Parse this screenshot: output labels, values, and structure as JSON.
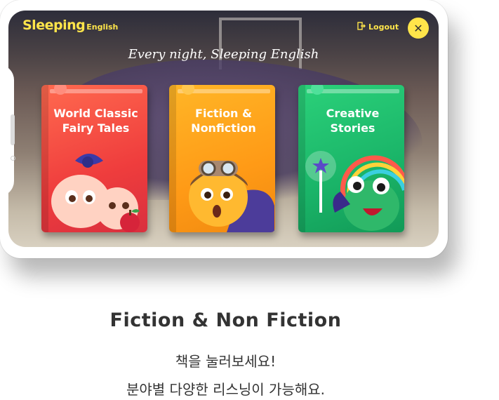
{
  "app": {
    "logo_main": "Sleeping",
    "logo_sub": "English",
    "logout_label": "Logout",
    "close_icon": "close-icon",
    "tagline": "Every night, Sleeping English"
  },
  "books": [
    {
      "title_line1": "World Classic",
      "title_line2": "Fairy Tales",
      "color": "#ef3d3d"
    },
    {
      "title_line1": "Fiction &",
      "title_line2": "Nonfiction",
      "color": "#ff9a16"
    },
    {
      "title_line1": "Creative",
      "title_line2": "Stories",
      "color": "#1ab468"
    }
  ],
  "caption": {
    "title": "Fiction & Non Fiction",
    "line1": "책을 눌러보세요!",
    "line2": "분야별 다양한 리스닝이 가능해요."
  },
  "colors": {
    "accent": "#ffe54a",
    "text_dark": "#333333"
  }
}
